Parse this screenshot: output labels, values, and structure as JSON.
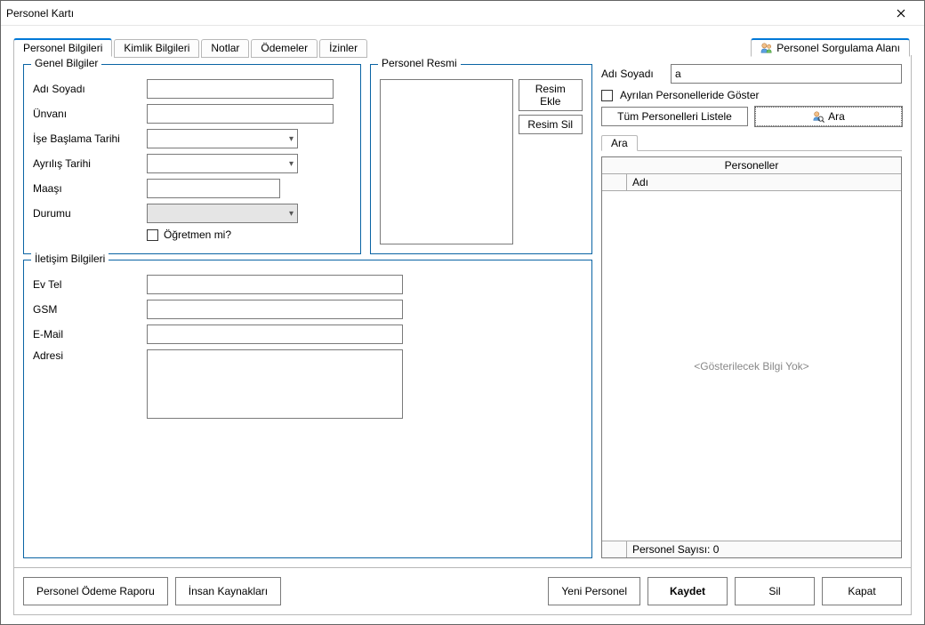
{
  "window": {
    "title": "Personel Kartı"
  },
  "tabs": {
    "personel_bilgileri": "Personel Bilgileri",
    "kimlik_bilgileri": "Kimlik Bilgileri",
    "notlar": "Notlar",
    "odemeler": "Ödemeler",
    "izinler": "İzinler",
    "sorgulama": "Personel Sorgulama Alanı"
  },
  "genel": {
    "legend": "Genel Bilgiler",
    "adi_soyadi_label": "Adı Soyadı",
    "adi_soyadi_value": "",
    "unvani_label": "Ünvanı",
    "unvani_value": "",
    "ise_baslama_label": "İşe Başlama Tarihi",
    "ise_baslama_value": "",
    "ayrilis_label": "Ayrılış Tarihi",
    "ayrilis_value": "",
    "maasi_label": "Maaşı",
    "maasi_value": "",
    "durumu_label": "Durumu",
    "durumu_value": "",
    "ogretmenmi_label": "Öğretmen mi?",
    "ogretmenmi_checked": false
  },
  "resmi": {
    "legend": "Personel Resmi",
    "resim_ekle": "Resim Ekle",
    "resim_sil": "Resim Sil"
  },
  "iletisim": {
    "legend": "İletişim Bilgileri",
    "ev_tel_label": "Ev Tel",
    "ev_tel_value": "",
    "gsm_label": "GSM",
    "gsm_value": "",
    "email_label": "E-Mail",
    "email_value": "",
    "adresi_label": "Adresi",
    "adresi_value": ""
  },
  "query": {
    "adi_soyadi_label": "Adı Soyadı",
    "adi_soyadi_value": "a",
    "ayrilan_label": "Ayrılan Personelleride Göster",
    "ayrilan_checked": false,
    "tum_listele": "Tüm Personelleri Listele",
    "ara_btn": "Ara",
    "ara_tab": "Ara",
    "grid_title": "Personeller",
    "grid_col_adi": "Adı",
    "empty": "<Gösterilecek Bilgi Yok>",
    "footer": "Personel Sayısı: 0"
  },
  "buttons": {
    "odeme_raporu": "Personel Ödeme Raporu",
    "insan_kaynaklari": "İnsan Kaynakları",
    "yeni_personel": "Yeni Personel",
    "kaydet": "Kaydet",
    "sil": "Sil",
    "kapat": "Kapat"
  }
}
